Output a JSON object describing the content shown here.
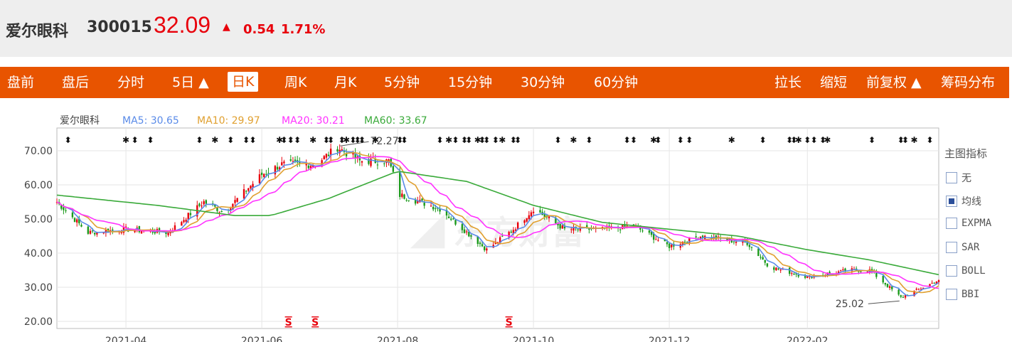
{
  "header": {
    "name": "爱尔眼科",
    "code": "300015",
    "price": "32.09",
    "arrow": "▲",
    "change": "0.54",
    "change_pct": "1.71%"
  },
  "toolbar": {
    "left_tabs": [
      "盘前",
      "盘后",
      "分时",
      "5日 ▲",
      "日K",
      "周K",
      "月K",
      "5分钟",
      "15分钟",
      "30分钟",
      "60分钟"
    ],
    "active_tab": "日K",
    "right_tabs": [
      "拉长",
      "缩短",
      "前复权 ▲",
      "筹码分布"
    ]
  },
  "legend": {
    "name": "爱尔眼科",
    "ma5": "MA5: 30.65",
    "ma10": "MA10: 29.97",
    "ma20": "MA20: 30.21",
    "ma60": "MA60: 33.67"
  },
  "colors": {
    "up": "#e8000b",
    "down": "#1a9a1a",
    "ma5": "#5a8be8",
    "ma10": "#e0a030",
    "ma20": "#ff33ff",
    "ma60": "#3aaa3a",
    "toolbar": "#e85400"
  },
  "side_panel": {
    "title": "主图指标",
    "options": [
      {
        "label": "无",
        "checked": false
      },
      {
        "label": "均线",
        "checked": true
      },
      {
        "label": "EXPMA",
        "checked": false
      },
      {
        "label": "SAR",
        "checked": false
      },
      {
        "label": "BOLL",
        "checked": false
      },
      {
        "label": "BBI",
        "checked": false
      }
    ]
  },
  "chart_data": {
    "type": "candlestick",
    "ylim": [
      20,
      75
    ],
    "y_ticks": [
      "70.00",
      "60.00",
      "50.00",
      "40.00",
      "30.00",
      "20.00"
    ],
    "x_labels": [
      "2021-04",
      "2021-06",
      "2021-08",
      "2021-10",
      "2021-12",
      "2022-02"
    ],
    "annotations": [
      {
        "text": "72.27",
        "type": "high"
      },
      {
        "text": "25.02",
        "type": "low"
      }
    ],
    "sell_markers": [
      "S",
      "S",
      "S"
    ],
    "anchors": [
      {
        "date": "2021-03-01",
        "close": 55
      },
      {
        "date": "2021-03-15",
        "close": 46
      },
      {
        "date": "2021-04-01",
        "close": 47
      },
      {
        "date": "2021-04-20",
        "close": 46
      },
      {
        "date": "2021-05-06",
        "close": 55
      },
      {
        "date": "2021-05-15",
        "close": 52
      },
      {
        "date": "2021-06-01",
        "close": 63
      },
      {
        "date": "2021-06-10",
        "close": 66
      },
      {
        "date": "2021-06-25",
        "close": 66
      },
      {
        "date": "2021-07-05",
        "close": 71
      },
      {
        "date": "2021-07-15",
        "close": 67
      },
      {
        "date": "2021-07-28",
        "close": 67
      },
      {
        "date": "2021-08-02",
        "close": 57
      },
      {
        "date": "2021-08-20",
        "close": 53
      },
      {
        "date": "2021-09-10",
        "close": 41
      },
      {
        "date": "2021-09-22",
        "close": 47
      },
      {
        "date": "2021-10-01",
        "close": 53
      },
      {
        "date": "2021-10-15",
        "close": 47
      },
      {
        "date": "2021-11-01",
        "close": 47
      },
      {
        "date": "2021-11-15",
        "close": 48
      },
      {
        "date": "2021-12-01",
        "close": 42
      },
      {
        "date": "2021-12-15",
        "close": 45
      },
      {
        "date": "2022-01-05",
        "close": 43
      },
      {
        "date": "2022-01-15",
        "close": 36
      },
      {
        "date": "2022-02-01",
        "close": 33
      },
      {
        "date": "2022-02-20",
        "close": 35
      },
      {
        "date": "2022-03-01",
        "close": 35
      },
      {
        "date": "2022-03-15",
        "close": 27
      },
      {
        "date": "2022-03-25",
        "close": 30
      },
      {
        "date": "2022-04-01",
        "close": 32.09
      }
    ],
    "ma60_anchors": [
      {
        "date": "2021-03-01",
        "value": 57
      },
      {
        "date": "2021-04-15",
        "value": 54
      },
      {
        "date": "2021-05-20",
        "value": 51
      },
      {
        "date": "2021-06-05",
        "value": 51
      },
      {
        "date": "2021-07-01",
        "value": 56
      },
      {
        "date": "2021-08-01",
        "value": 64
      },
      {
        "date": "2021-09-01",
        "value": 61
      },
      {
        "date": "2021-10-01",
        "value": 54
      },
      {
        "date": "2021-11-01",
        "value": 49
      },
      {
        "date": "2021-12-01",
        "value": 47
      },
      {
        "date": "2022-01-01",
        "value": 45
      },
      {
        "date": "2022-02-01",
        "value": 41
      },
      {
        "date": "2022-03-01",
        "value": 38
      },
      {
        "date": "2022-04-01",
        "value": 33.67
      }
    ]
  }
}
